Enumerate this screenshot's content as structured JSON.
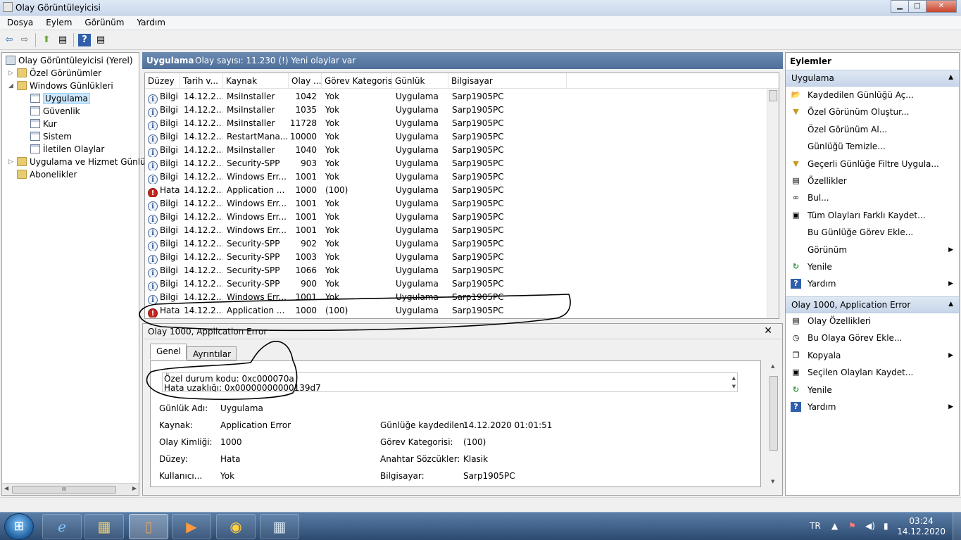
{
  "window": {
    "title": "Olay Görüntüleyicisi",
    "btn_min": "▁",
    "btn_max": "□",
    "btn_close": "✕"
  },
  "menu": [
    "Dosya",
    "Eylem",
    "Görünüm",
    "Yardım"
  ],
  "toolbar": {
    "back": "⇦",
    "forward": "⇨",
    "up": "⬆",
    "panel": "▤",
    "help": "?",
    "panel2": "▤"
  },
  "tree": {
    "root": "Olay Görüntüleyicisi (Yerel)",
    "custom_views": "Özel Görünümler",
    "windows_logs": "Windows Günlükleri",
    "application": "Uygulama",
    "security": "Güvenlik",
    "setup": "Kur",
    "system": "Sistem",
    "forwarded": "İletilen Olaylar",
    "app_service": "Uygulama ve Hizmet Günlük",
    "subscriptions": "Abonelikler",
    "scroll_grip": "III"
  },
  "center": {
    "log_name": "Uygulama",
    "summary": "Olay sayısı: 11.230 (!) Yeni olaylar var"
  },
  "table": {
    "columns": [
      "Düzey",
      "Tarih v...",
      "Kaynak",
      "Olay ...",
      "Görev Kategorisi",
      "Günlük",
      "Bilgisayar"
    ],
    "rows": [
      {
        "level": "Bilgi",
        "date": "14.12.2...",
        "source": "MsiInstaller",
        "id": "1042",
        "task": "Yok",
        "log": "Uygulama",
        "computer": "Sarp1905PC",
        "icon": "info"
      },
      {
        "level": "Bilgi",
        "date": "14.12.2...",
        "source": "MsiInstaller",
        "id": "1035",
        "task": "Yok",
        "log": "Uygulama",
        "computer": "Sarp1905PC",
        "icon": "info"
      },
      {
        "level": "Bilgi",
        "date": "14.12.2...",
        "source": "MsiInstaller",
        "id": "11728",
        "task": "Yok",
        "log": "Uygulama",
        "computer": "Sarp1905PC",
        "icon": "info"
      },
      {
        "level": "Bilgi",
        "date": "14.12.2...",
        "source": "RestartMana...",
        "id": "10000",
        "task": "Yok",
        "log": "Uygulama",
        "computer": "Sarp1905PC",
        "icon": "info"
      },
      {
        "level": "Bilgi",
        "date": "14.12.2...",
        "source": "MsiInstaller",
        "id": "1040",
        "task": "Yok",
        "log": "Uygulama",
        "computer": "Sarp1905PC",
        "icon": "info"
      },
      {
        "level": "Bilgi",
        "date": "14.12.2...",
        "source": "Security-SPP",
        "id": "903",
        "task": "Yok",
        "log": "Uygulama",
        "computer": "Sarp1905PC",
        "icon": "info"
      },
      {
        "level": "Bilgi",
        "date": "14.12.2...",
        "source": "Windows Err...",
        "id": "1001",
        "task": "Yok",
        "log": "Uygulama",
        "computer": "Sarp1905PC",
        "icon": "info"
      },
      {
        "level": "Hata",
        "date": "14.12.2...",
        "source": "Application ...",
        "id": "1000",
        "task": "(100)",
        "log": "Uygulama",
        "computer": "Sarp1905PC",
        "icon": "error"
      },
      {
        "level": "Bilgi",
        "date": "14.12.2...",
        "source": "Windows Err...",
        "id": "1001",
        "task": "Yok",
        "log": "Uygulama",
        "computer": "Sarp1905PC",
        "icon": "info"
      },
      {
        "level": "Bilgi",
        "date": "14.12.2...",
        "source": "Windows Err...",
        "id": "1001",
        "task": "Yok",
        "log": "Uygulama",
        "computer": "Sarp1905PC",
        "icon": "info"
      },
      {
        "level": "Bilgi",
        "date": "14.12.2...",
        "source": "Windows Err...",
        "id": "1001",
        "task": "Yok",
        "log": "Uygulama",
        "computer": "Sarp1905PC",
        "icon": "info"
      },
      {
        "level": "Bilgi",
        "date": "14.12.2...",
        "source": "Security-SPP",
        "id": "902",
        "task": "Yok",
        "log": "Uygulama",
        "computer": "Sarp1905PC",
        "icon": "info"
      },
      {
        "level": "Bilgi",
        "date": "14.12.2...",
        "source": "Security-SPP",
        "id": "1003",
        "task": "Yok",
        "log": "Uygulama",
        "computer": "Sarp1905PC",
        "icon": "info"
      },
      {
        "level": "Bilgi",
        "date": "14.12.2...",
        "source": "Security-SPP",
        "id": "1066",
        "task": "Yok",
        "log": "Uygulama",
        "computer": "Sarp1905PC",
        "icon": "info"
      },
      {
        "level": "Bilgi",
        "date": "14.12.2...",
        "source": "Security-SPP",
        "id": "900",
        "task": "Yok",
        "log": "Uygulama",
        "computer": "Sarp1905PC",
        "icon": "info"
      },
      {
        "level": "Bilgi",
        "date": "14.12.2...",
        "source": "Windows Err...",
        "id": "1001",
        "task": "Yok",
        "log": "Uygulama",
        "computer": "Sarp1905PC",
        "icon": "info"
      },
      {
        "level": "Hata",
        "date": "14.12.2...",
        "source": "Application ...",
        "id": "1000",
        "task": "(100)",
        "log": "Uygulama",
        "computer": "Sarp1905PC",
        "icon": "error"
      }
    ]
  },
  "detail": {
    "title": "Olay 1000, Application Error",
    "close": "✕",
    "tab_general": "Genel",
    "tab_details": "Ayrıntılar",
    "desc_line1": "Özel durum kodu: 0xc000070a",
    "desc_line2": "Hata uzaklığı: 0x00000000000139d7",
    "log_name_label": "Günlük Adı:",
    "log_name_value": "Uygulama",
    "source_label": "Kaynak:",
    "source_value": "Application Error",
    "logged_label": "Günlüğe kaydedilen:",
    "logged_value": "14.12.2020 01:01:51",
    "eventid_label": "Olay Kimliği:",
    "eventid_value": "1000",
    "task_label": "Görev Kategorisi:",
    "task_value": "(100)",
    "level_label": "Düzey:",
    "level_value": "Hata",
    "keywords_label": "Anahtar Sözcükler:",
    "keywords_value": "Klasik",
    "user_label": "Kullanıcı...",
    "user_value": "Yok",
    "computer_label": "Bilgisayar:",
    "computer_value": "Sarp1905PC"
  },
  "actions": {
    "title": "Eylemler",
    "section1": "Uygulama",
    "items1": [
      {
        "label": "Kaydedilen Günlüğü Aç...",
        "icon": "folder-open-icon",
        "glyph": "📂"
      },
      {
        "label": "Özel Görünüm Oluştur...",
        "icon": "filter-icon",
        "glyph": "▼"
      },
      {
        "label": "Özel Görünüm Al...",
        "icon": "",
        "glyph": ""
      },
      {
        "label": "Günlüğü Temizle...",
        "icon": "",
        "glyph": ""
      },
      {
        "label": "Geçerli Günlüğe Filtre Uygula...",
        "icon": "filter-icon",
        "glyph": "▼"
      },
      {
        "label": "Özellikler",
        "icon": "properties-icon",
        "glyph": "▤"
      },
      {
        "label": "Bul...",
        "icon": "binoculars-icon",
        "glyph": "∞"
      },
      {
        "label": "Tüm Olayları Farklı Kaydet...",
        "icon": "save-icon",
        "glyph": "▣"
      },
      {
        "label": "Bu Günlüğe Görev Ekle...",
        "icon": "",
        "glyph": ""
      },
      {
        "label": "Görünüm",
        "icon": "",
        "glyph": "",
        "submenu": "▶"
      },
      {
        "label": "Yenile",
        "icon": "refresh-icon",
        "glyph": "↻"
      },
      {
        "label": "Yardım",
        "icon": "help-icon",
        "glyph": "?",
        "submenu": "▶"
      }
    ],
    "section2": "Olay 1000, Application Error",
    "items2": [
      {
        "label": "Olay Özellikleri",
        "icon": "properties-icon",
        "glyph": "▤"
      },
      {
        "label": "Bu Olaya Görev Ekle...",
        "icon": "task-icon",
        "glyph": "◷"
      },
      {
        "label": "Kopyala",
        "icon": "copy-icon",
        "glyph": "❐",
        "submenu": "▶"
      },
      {
        "label": "Seçilen Olayları Kaydet...",
        "icon": "save-icon",
        "glyph": "▣"
      },
      {
        "label": "Yenile",
        "icon": "refresh-icon",
        "glyph": "↻"
      },
      {
        "label": "Yardım",
        "icon": "help-icon",
        "glyph": "?",
        "submenu": "▶"
      }
    ]
  },
  "taskbar": {
    "start": "⊞",
    "lang": "TR",
    "time": "03:24",
    "date": "14.12.2020",
    "apps": [
      "e",
      "▦",
      "▯",
      "▶",
      "◉",
      "▦"
    ]
  }
}
